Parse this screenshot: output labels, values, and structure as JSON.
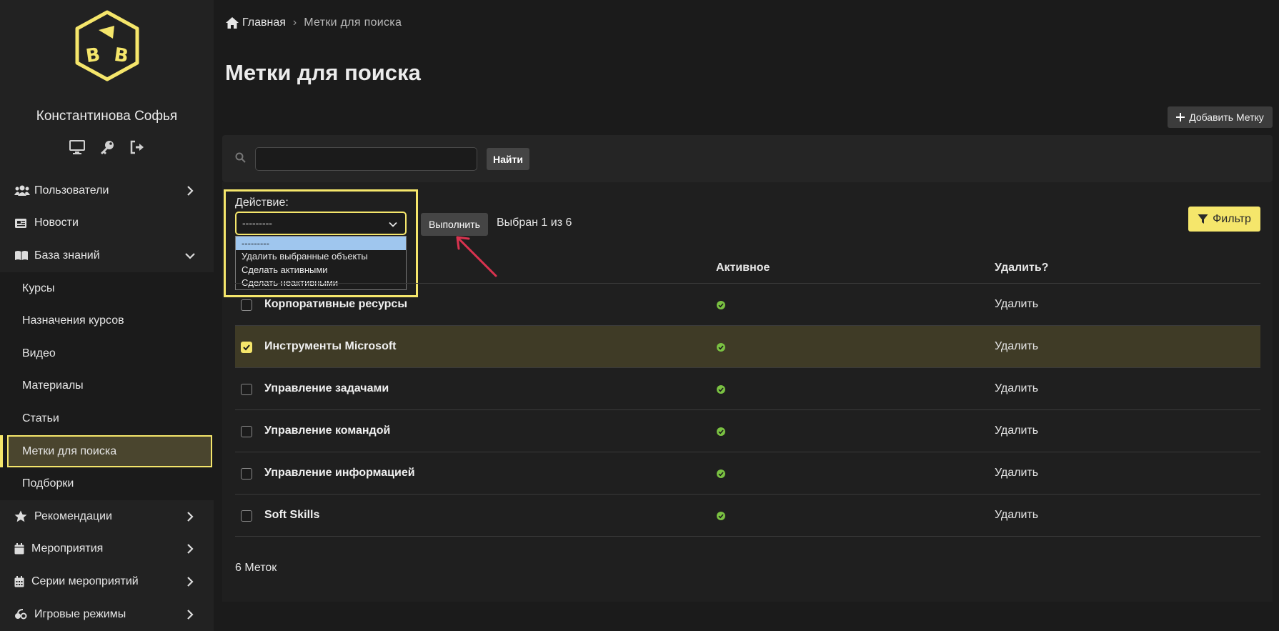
{
  "user": {
    "name": "Константинова Софья"
  },
  "sidebar": {
    "items": [
      {
        "label": "Пользователи"
      },
      {
        "label": "Новости"
      },
      {
        "label": "База знаний"
      }
    ],
    "subitems": [
      {
        "label": "Курсы"
      },
      {
        "label": "Назначения курсов"
      },
      {
        "label": "Видео"
      },
      {
        "label": "Материалы"
      },
      {
        "label": "Статьи"
      },
      {
        "label": "Метки для поиска"
      },
      {
        "label": "Подборки"
      }
    ],
    "items_after": [
      {
        "label": "Рекомендации"
      },
      {
        "label": "Мероприятия"
      },
      {
        "label": "Серии мероприятий"
      },
      {
        "label": "Игровые режимы"
      }
    ]
  },
  "breadcrumb": {
    "home": "Главная",
    "separator": "›",
    "current": "Метки  для  поиска"
  },
  "page": {
    "title": "Метки для поиска"
  },
  "toolbar": {
    "add_label": "Добавить Метку",
    "filter_label": "Фильтр"
  },
  "search": {
    "button": "Найти",
    "value": ""
  },
  "actions": {
    "label": "Действие:",
    "selected": "---------",
    "options": [
      "---------",
      "Удалить выбранные объекты",
      "Сделать активными",
      "Сделать неактивными"
    ],
    "run_label": "Выполнить",
    "selected_count": "Выбран 1 из 6"
  },
  "table": {
    "headers": {
      "active": "Активное",
      "delete": "Удалить?"
    },
    "rows": [
      {
        "name": "Корпоративные ресурсы",
        "delete": "Удалить",
        "checked": false
      },
      {
        "name": "Инструменты Microsoft",
        "delete": "Удалить",
        "checked": true
      },
      {
        "name": "Управление задачами",
        "delete": "Удалить",
        "checked": false
      },
      {
        "name": "Управление командой",
        "delete": "Удалить",
        "checked": false
      },
      {
        "name": "Управление информацией",
        "delete": "Удалить",
        "checked": false
      },
      {
        "name": "Soft Skills",
        "delete": "Удалить",
        "checked": false
      }
    ],
    "total": "6 Меток"
  },
  "colors": {
    "accent": "#f5e66b",
    "success": "#7ac142",
    "annotation": "#d9334f"
  }
}
